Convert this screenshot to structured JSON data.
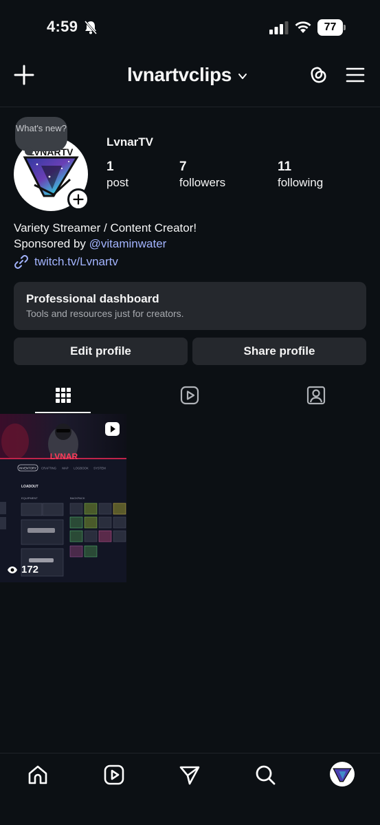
{
  "status_bar": {
    "time": "4:59",
    "battery": "77"
  },
  "header": {
    "username": "lvnartvclips"
  },
  "profile": {
    "whats_new": "What's new?",
    "display_name": "LvnarTV",
    "stats": [
      {
        "value": "1",
        "label": "post"
      },
      {
        "value": "7",
        "label": "followers"
      },
      {
        "value": "11",
        "label": "following"
      }
    ],
    "bio_line1": "Variety Streamer / Content Creator!",
    "bio_sponsored_prefix": "Sponsored by ",
    "bio_mention": "@vitaminwater",
    "link": "twitch.tv/Lvnartv",
    "avatar_text": "LVNARTV"
  },
  "professional_dashboard": {
    "title": "Professional dashboard",
    "subtitle": "Tools and resources just for creators."
  },
  "buttons": {
    "edit": "Edit profile",
    "share": "Share profile"
  },
  "tabs": [
    "grid-icon",
    "reels-icon",
    "tagged-icon"
  ],
  "posts": [
    {
      "views": "172",
      "thumb_brand": "LVNAR",
      "thumb_tabs": [
        "INVENTORY",
        "CRAFTING",
        "MAP",
        "LOGBOOK",
        "SYSTEM"
      ],
      "thumb_loadout": "LOADOUT",
      "thumb_equipment": "EQUIPMENT",
      "thumb_backpack": "BACKPACK"
    }
  ],
  "bottom_nav": [
    "home-icon",
    "reels-icon",
    "send-icon",
    "search-icon",
    "profile-avatar"
  ],
  "colors": {
    "background": "#0c1014",
    "card": "#25282d",
    "link": "#a3b4ff"
  }
}
